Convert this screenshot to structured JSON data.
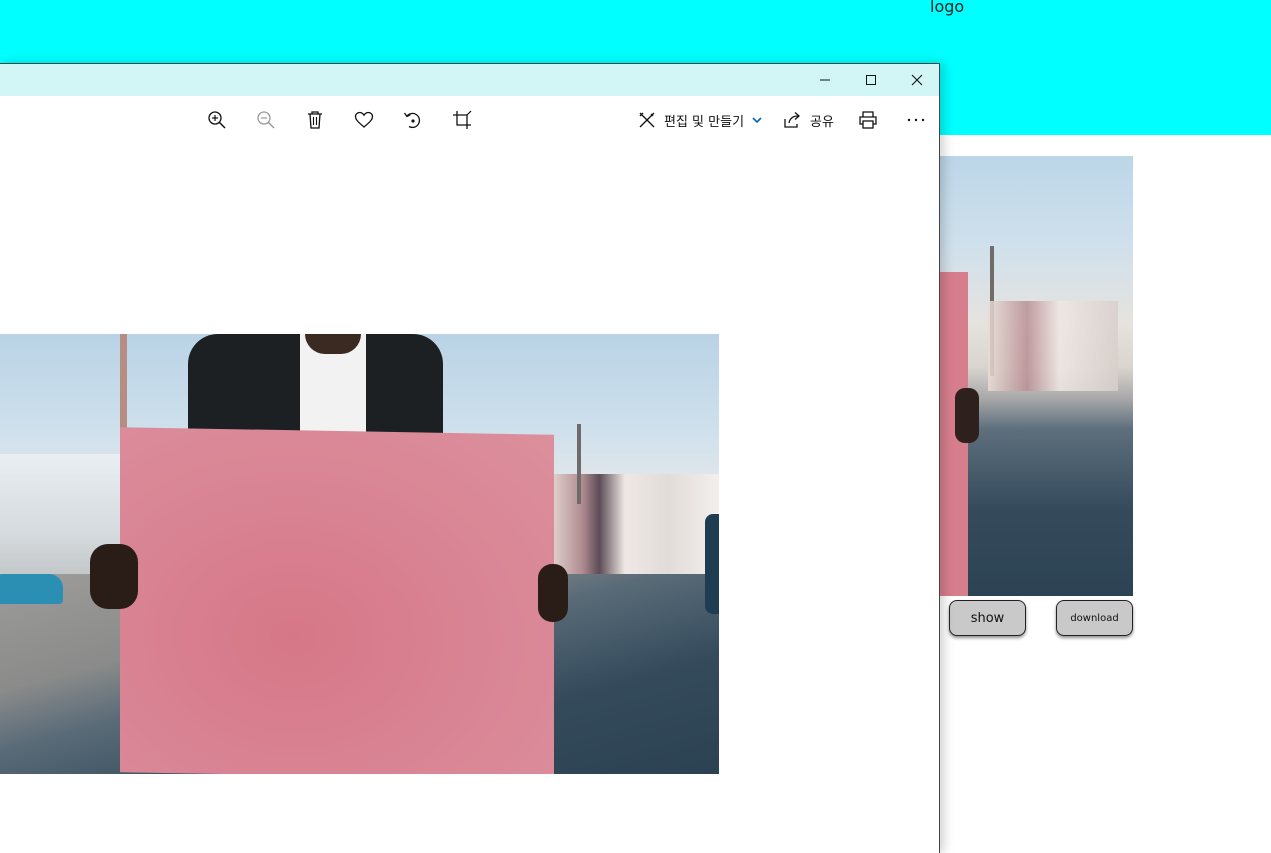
{
  "background_page": {
    "logo_text": "logo",
    "header_color": "#00ffff",
    "buttons": {
      "show_label": "show",
      "download_label": "download"
    }
  },
  "window": {
    "titlebar_color": "#d2f6f5",
    "caption_buttons": [
      "minimize-icon",
      "maximize-icon",
      "close-icon"
    ]
  },
  "toolbar": {
    "icons": [
      "zoom-in-icon",
      "zoom-out-icon",
      "delete-icon",
      "favorite-icon",
      "rotate-icon",
      "crop-icon"
    ],
    "edit_label": "편집 및 만들기",
    "share_label": "공유",
    "print_icon": "print-icon",
    "more_icon": "more-icon",
    "accent_color": "#0067c0"
  },
  "photo": {
    "description_icon": "photo-image"
  }
}
